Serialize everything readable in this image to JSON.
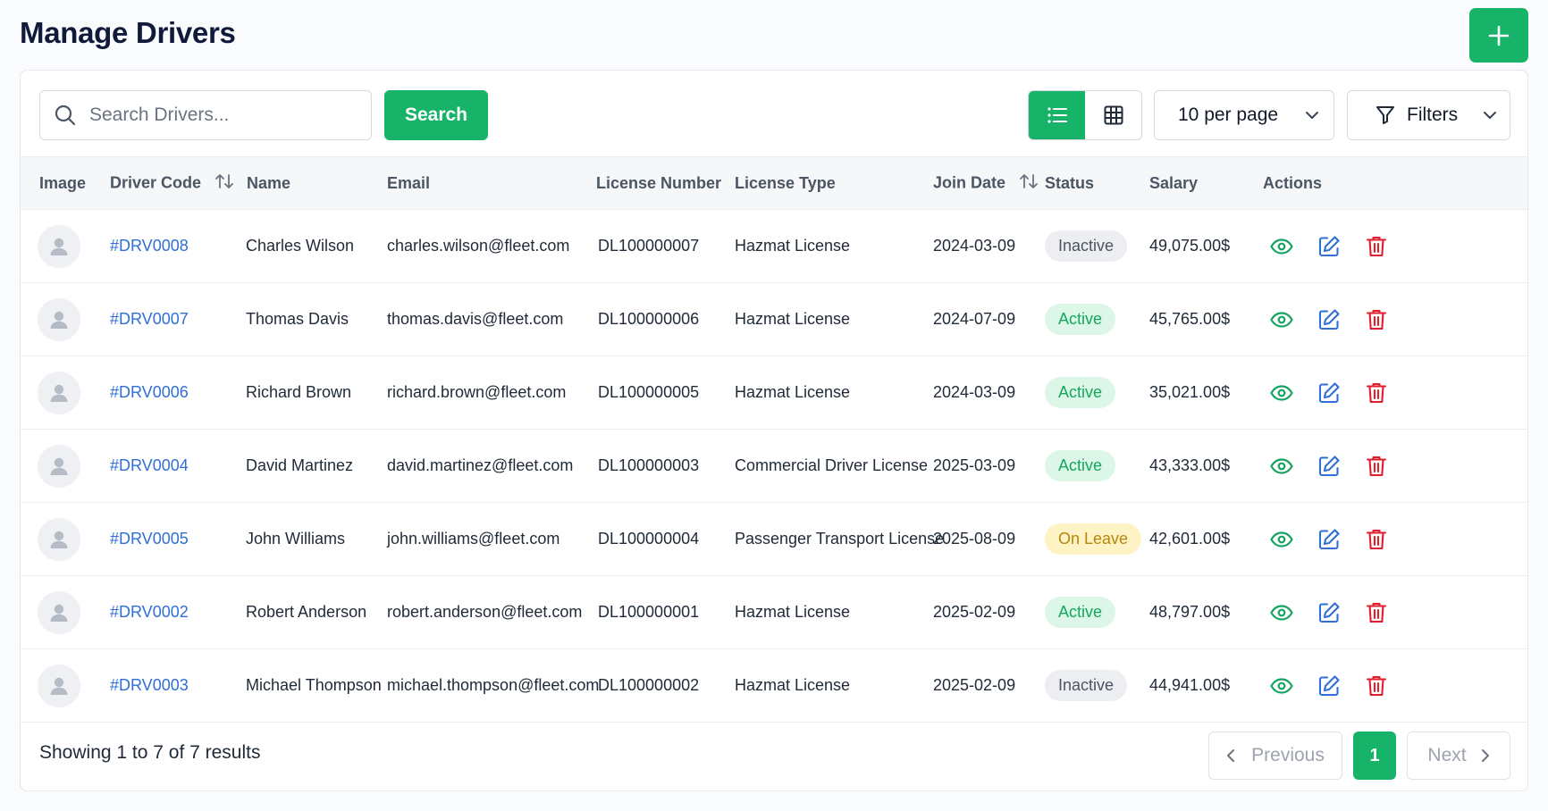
{
  "page": {
    "title": "Manage Drivers",
    "add_button_icon": "plus-icon"
  },
  "toolbar": {
    "search_placeholder": "Search Drivers...",
    "search_value": "",
    "search_button": "Search",
    "view_modes": [
      "list-view-icon",
      "grid-view-icon"
    ],
    "active_view": "list",
    "per_page": "10 per page",
    "filters_label": "Filters"
  },
  "table": {
    "columns": [
      "Image",
      "Driver Code",
      "Name",
      "Email",
      "License Number",
      "License Type",
      "Join Date",
      "Status",
      "Salary",
      "Actions"
    ],
    "sortable": [
      "Driver Code",
      "Join Date"
    ],
    "rows": [
      {
        "code": "#DRV0008",
        "name": "Charles Wilson",
        "email": "charles.wilson@fleet.com",
        "license_number": "DL100000007",
        "license_type": "Hazmat License",
        "join_date": "2024-03-09",
        "status": "Inactive",
        "salary": "49,075.00$"
      },
      {
        "code": "#DRV0007",
        "name": "Thomas Davis",
        "email": "thomas.davis@fleet.com",
        "license_number": "DL100000006",
        "license_type": "Hazmat License",
        "join_date": "2024-07-09",
        "status": "Active",
        "salary": "45,765.00$"
      },
      {
        "code": "#DRV0006",
        "name": "Richard Brown",
        "email": "richard.brown@fleet.com",
        "license_number": "DL100000005",
        "license_type": "Hazmat License",
        "join_date": "2024-03-09",
        "status": "Active",
        "salary": "35,021.00$"
      },
      {
        "code": "#DRV0004",
        "name": "David Martinez",
        "email": "david.martinez@fleet.com",
        "license_number": "DL100000003",
        "license_type": "Commercial Driver License",
        "join_date": "2025-03-09",
        "status": "Active",
        "salary": "43,333.00$"
      },
      {
        "code": "#DRV0005",
        "name": "John Williams",
        "email": "john.williams@fleet.com",
        "license_number": "DL100000004",
        "license_type": "Passenger Transport License",
        "join_date": "2025-08-09",
        "status": "On Leave",
        "salary": "42,601.00$"
      },
      {
        "code": "#DRV0002",
        "name": "Robert Anderson",
        "email": "robert.anderson@fleet.com",
        "license_number": "DL100000001",
        "license_type": "Hazmat License",
        "join_date": "2025-02-09",
        "status": "Active",
        "salary": "48,797.00$"
      },
      {
        "code": "#DRV0003",
        "name": "Michael Thompson",
        "email": "michael.thompson@fleet.com",
        "license_number": "DL100000002",
        "license_type": "Hazmat License",
        "join_date": "2025-02-09",
        "status": "Inactive",
        "salary": "44,941.00$"
      }
    ]
  },
  "pagination": {
    "summary": "Showing 1 to 7 of 7 results",
    "previous": "Previous",
    "current_page": "1",
    "next": "Next"
  },
  "colors": {
    "primary": "#16b369",
    "link": "#2f6fd6",
    "edit": "#2f6fd6",
    "delete": "#e11d2e",
    "view": "#16a35f"
  }
}
